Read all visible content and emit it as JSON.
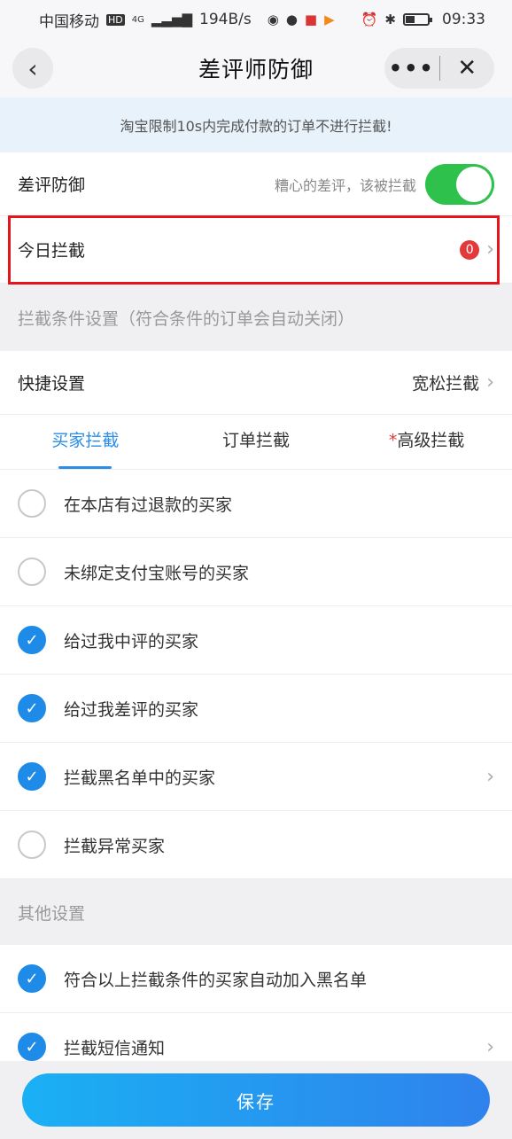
{
  "status_bar": {
    "carrier": "中国移动",
    "hd": "HD",
    "network": "4G",
    "speed": "194B/s",
    "time": "09:33"
  },
  "navbar": {
    "title": "差评师防御",
    "back_icon": "chevron-left-icon",
    "more_label": "•••",
    "close_label": "✕"
  },
  "notice": "淘宝限制10s内完成付款的订单不进行拦截!",
  "defense": {
    "label": "差评防御",
    "hint": "糟心的差评，该被拦截",
    "enabled": true,
    "toggle_color": "#2ec14c"
  },
  "today": {
    "label": "今日拦截",
    "count": "0"
  },
  "conditions_header": "拦截条件设置（符合条件的订单会自动关闭）",
  "quick": {
    "label": "快捷设置",
    "value": "宽松拦截"
  },
  "tabs": [
    {
      "label": "买家拦截",
      "active": true
    },
    {
      "label": "订单拦截",
      "active": false
    },
    {
      "star": "*",
      "label": "高级拦截",
      "active": false
    }
  ],
  "buyer_options": [
    {
      "label": "在本店有过退款的买家",
      "checked": false
    },
    {
      "label": "未绑定支付宝账号的买家",
      "checked": false
    },
    {
      "label": "给过我中评的买家",
      "checked": true
    },
    {
      "label": "给过我差评的买家",
      "checked": true
    },
    {
      "label": "拦截黑名单中的买家",
      "checked": true,
      "has_arrow": true
    },
    {
      "label": "拦截异常买家",
      "checked": false
    }
  ],
  "other_header": "其他设置",
  "other_options": [
    {
      "label": "符合以上拦截条件的买家自动加入黑名单",
      "checked": true
    },
    {
      "label": "拦截短信通知",
      "checked": true,
      "has_arrow": true
    }
  ],
  "save_label": "保存",
  "colors": {
    "accent": "#2a8ee8",
    "check": "#1e8be8",
    "highlight": "#e8141b",
    "badge": "#e23a3a"
  }
}
